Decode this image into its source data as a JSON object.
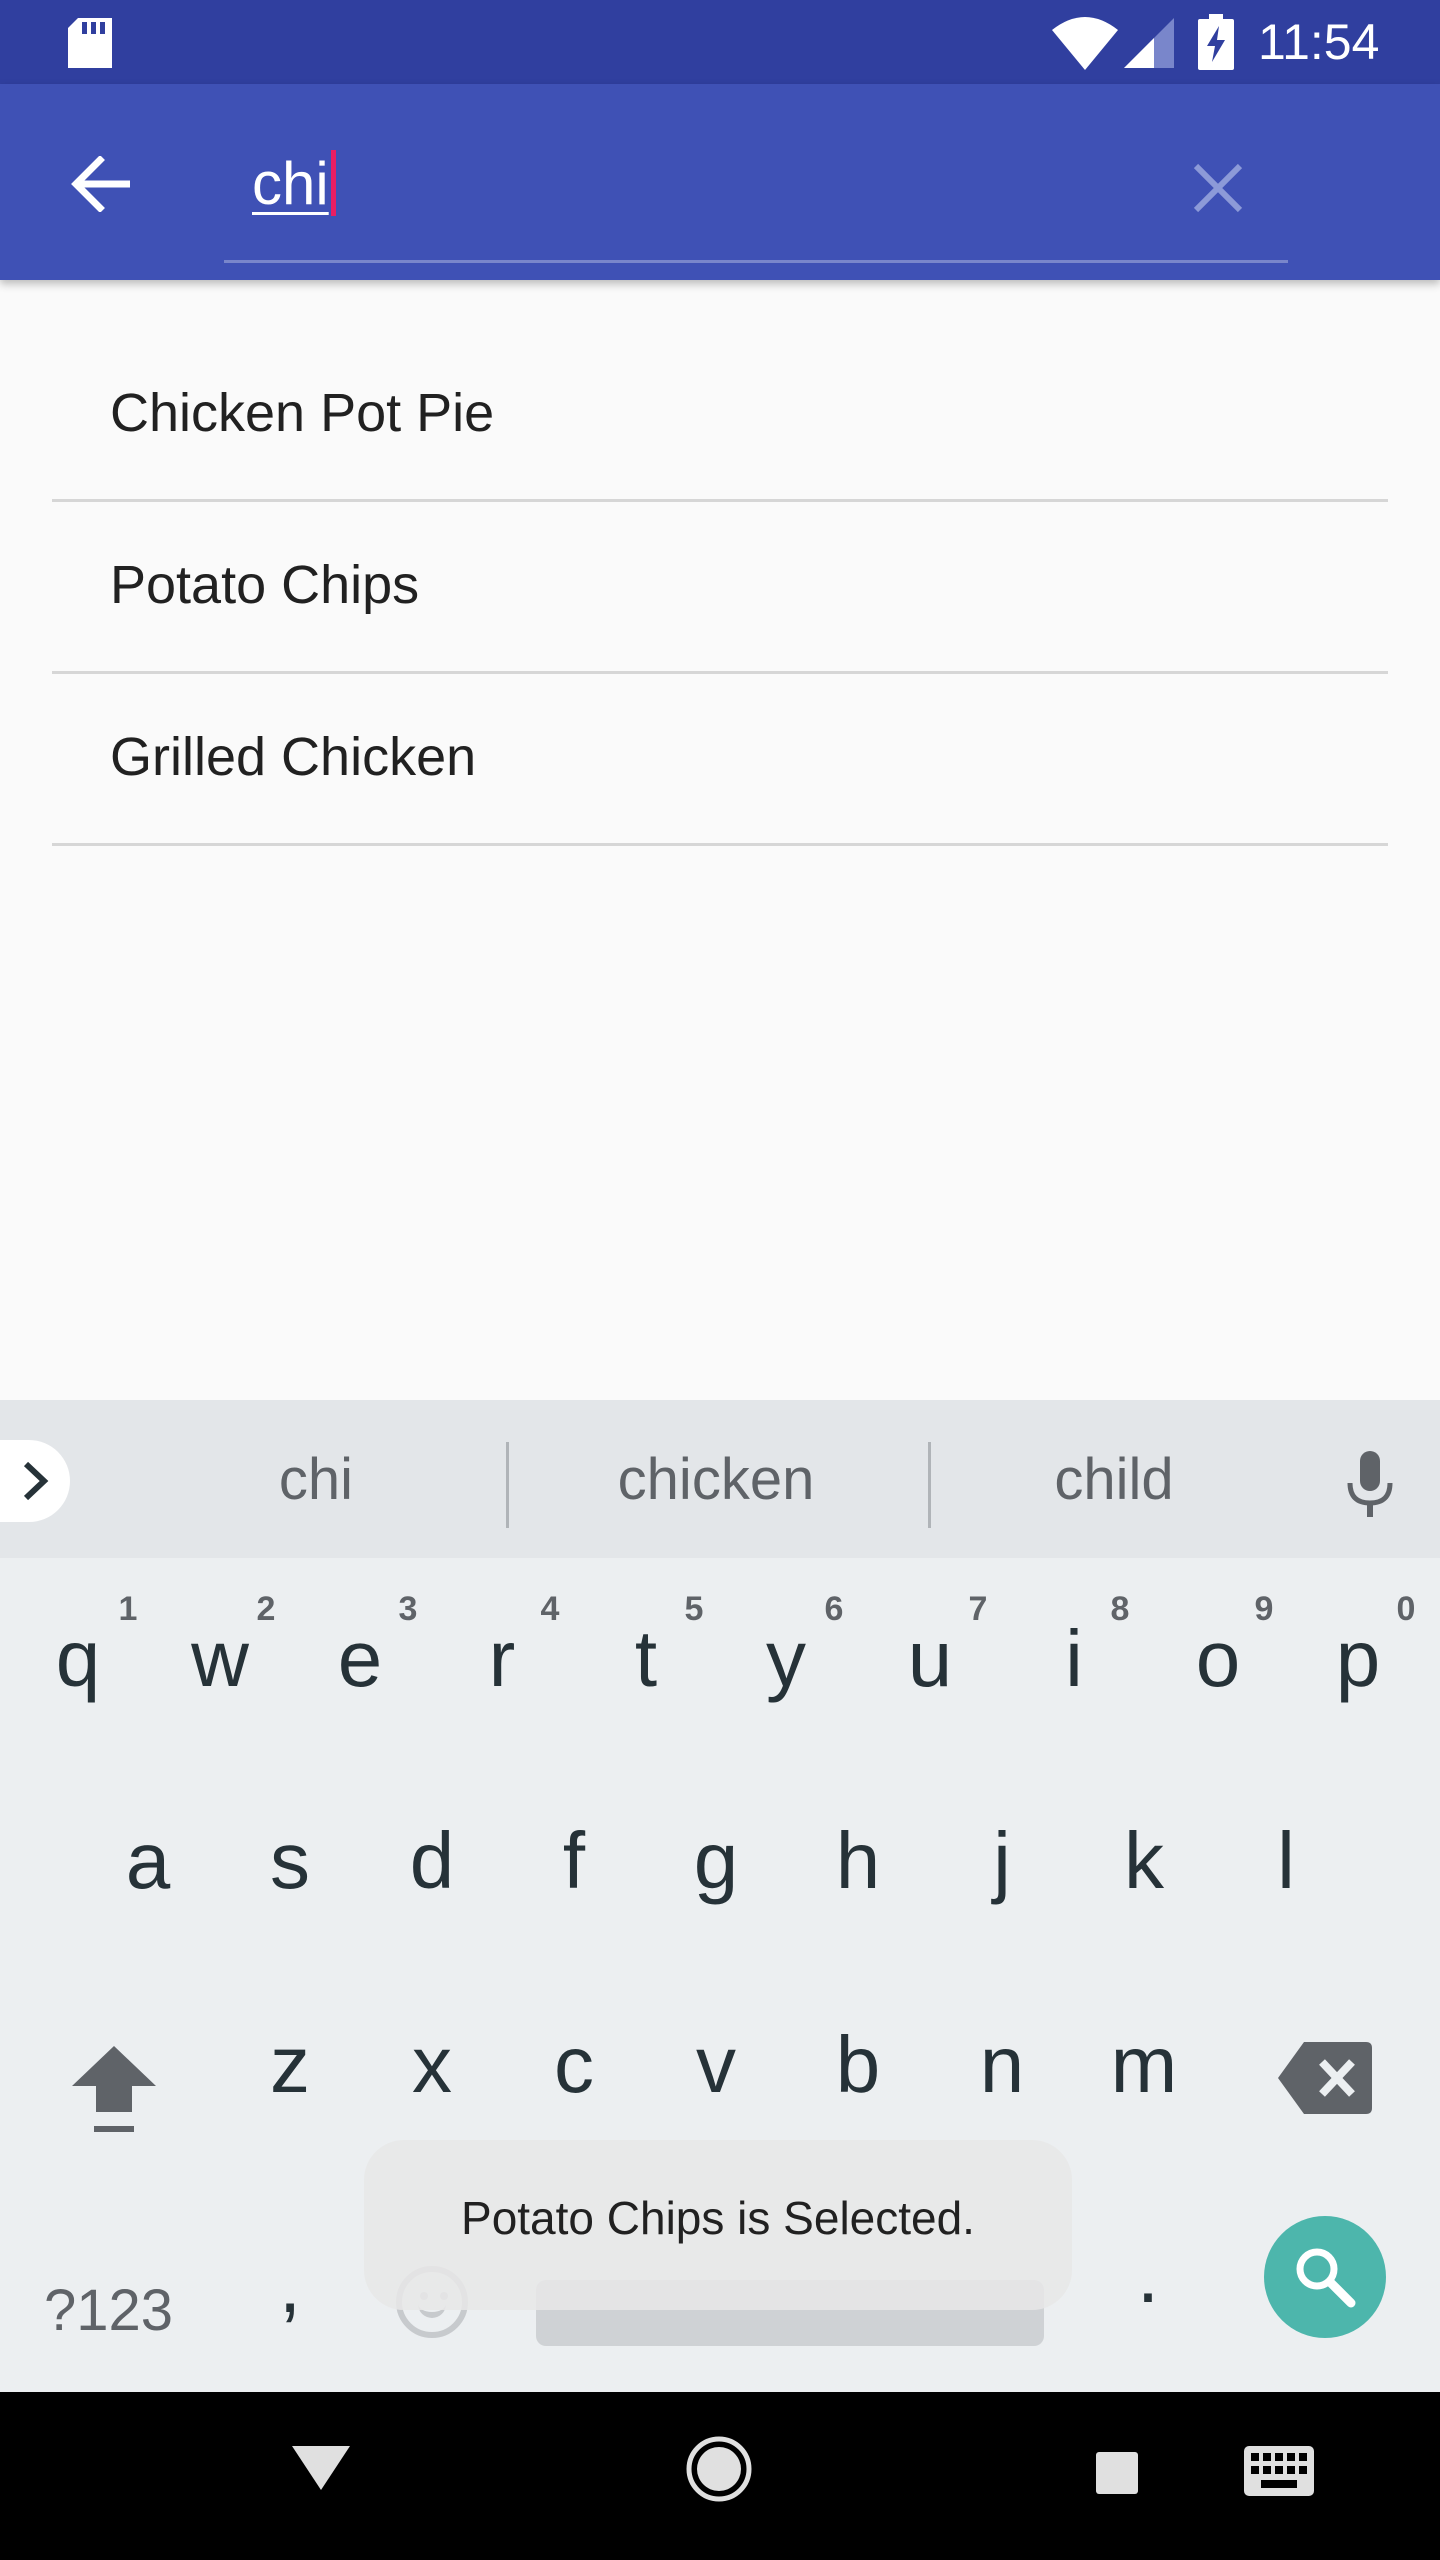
{
  "status_bar": {
    "time": "11:54",
    "icons": [
      "sd-card-icon",
      "wifi-icon",
      "cellular-signal-icon",
      "battery-charging-icon"
    ],
    "color": "#303f9f"
  },
  "app_bar": {
    "back_icon": "arrow-back-icon",
    "search_value": "chi",
    "clear_icon": "close-icon",
    "color": "#3f51b5"
  },
  "results": [
    {
      "label": "Chicken Pot Pie"
    },
    {
      "label": "Potato Chips"
    },
    {
      "label": "Grilled Chicken"
    }
  ],
  "keyboard": {
    "suggestions": [
      "chi",
      "chicken",
      "child"
    ],
    "row1": [
      "q",
      "w",
      "e",
      "r",
      "t",
      "y",
      "u",
      "i",
      "o",
      "p"
    ],
    "row1_hints": [
      "1",
      "2",
      "3",
      "4",
      "5",
      "6",
      "7",
      "8",
      "9",
      "0"
    ],
    "row2": [
      "a",
      "s",
      "d",
      "f",
      "g",
      "h",
      "j",
      "k",
      "l"
    ],
    "row3": [
      "z",
      "x",
      "c",
      "v",
      "b",
      "n",
      "m"
    ],
    "symbols_label": "?123",
    "comma": ",",
    "period": ".",
    "action_icon": "search-icon",
    "action_color": "#4db6ac"
  },
  "toast": {
    "message": "Potato Chips is Selected."
  },
  "nav_bar": {
    "icons": [
      "nav-back-icon",
      "nav-home-icon",
      "nav-recents-icon",
      "keyboard-switch-icon"
    ]
  }
}
